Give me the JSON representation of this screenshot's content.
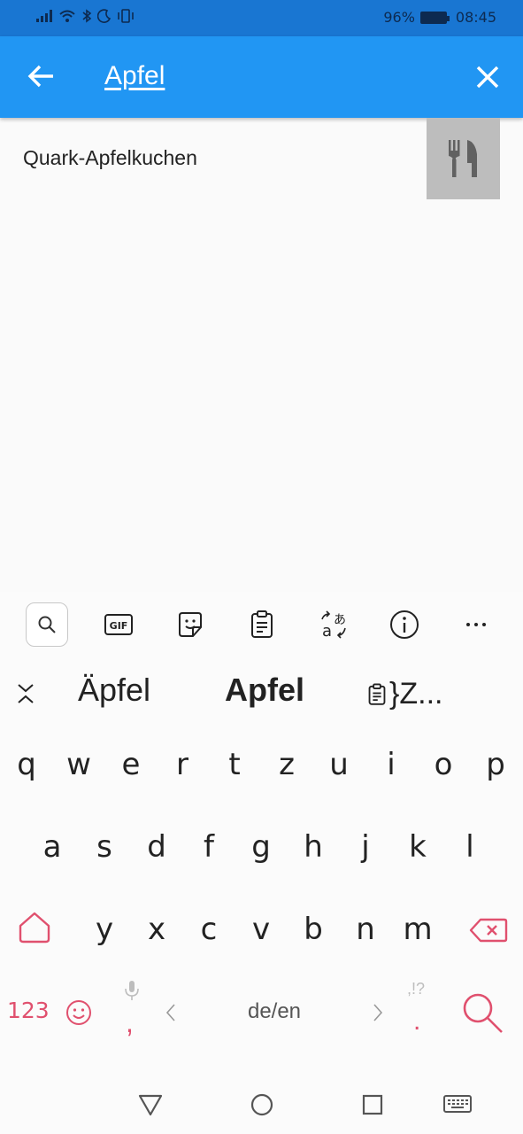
{
  "status_bar": {
    "battery": "96%",
    "time": "08:45"
  },
  "app_bar": {
    "query": "Apfel"
  },
  "results": [
    {
      "title": "Quark-Apfelkuchen"
    }
  ],
  "keyboard": {
    "suggestions": [
      "Äpfel",
      "Apfel",
      "}Z..."
    ],
    "rows": [
      [
        "q",
        "w",
        "e",
        "r",
        "t",
        "z",
        "u",
        "i",
        "o",
        "p"
      ],
      [
        "a",
        "s",
        "d",
        "f",
        "g",
        "h",
        "j",
        "k",
        "l"
      ],
      [
        "y",
        "x",
        "c",
        "v",
        "b",
        "n",
        "m"
      ]
    ],
    "bottom": {
      "numbers": "123",
      "comma": ",",
      "lang": "de/en",
      "punct_hint": ",!?",
      "period": "."
    },
    "accent_color": "#e0506e"
  }
}
